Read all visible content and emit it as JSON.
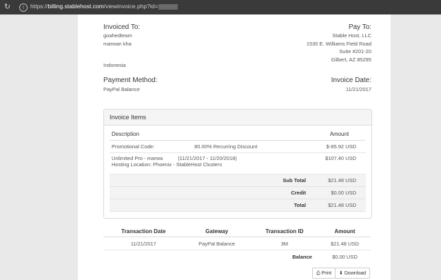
{
  "browser": {
    "url_host": "billing.stablehost.com",
    "url_prefix": "https://",
    "url_path": "/viewinvoice.php?id="
  },
  "invoiced_to": {
    "label": "Invoiced To:",
    "lines": [
      "goahedteam",
      "marwan kha"
    ],
    "country": "Indonesia"
  },
  "pay_to": {
    "label": "Pay To:",
    "lines": [
      "Stable Host, LLC",
      "1530 E. Williams Field Road",
      "Suite #201-20",
      "Gilbert, AZ 85295"
    ]
  },
  "payment_method": {
    "label": "Payment Method:",
    "value": "PayPal Balance"
  },
  "invoice_date": {
    "label": "Invoice Date:",
    "value": "11/21/2017"
  },
  "items": {
    "title": "Invoice Items",
    "col_description": "Description",
    "col_amount": "Amount",
    "rows": [
      {
        "desc": "Promotional Code:",
        "extra": "80.00% Recurring Discount",
        "amount": "$-85.92 USD"
      },
      {
        "desc": "Unlimited Pro - marwa",
        "extra": "(11/21/2017 - 11/20/2018)",
        "desc2": "Hosting Location: Phoenix - StableHost Clusters",
        "amount": "$107.40 USD"
      }
    ],
    "sub_total_label": "Sub Total",
    "sub_total": "$21.48 USD",
    "credit_label": "Credit",
    "credit": "$0.00 USD",
    "total_label": "Total",
    "total": "$21.48 USD"
  },
  "transactions": {
    "col_date": "Transaction Date",
    "col_gateway": "Gateway",
    "col_id": "Transaction ID",
    "col_amount": "Amount",
    "rows": [
      {
        "date": "11/21/2017",
        "gateway": "PayPal Balance",
        "id": "3M",
        "amount": "$21.48 USD"
      }
    ],
    "balance_label": "Balance",
    "balance": "$0.00 USD"
  },
  "buttons": {
    "print": "Print",
    "download": "Download"
  }
}
